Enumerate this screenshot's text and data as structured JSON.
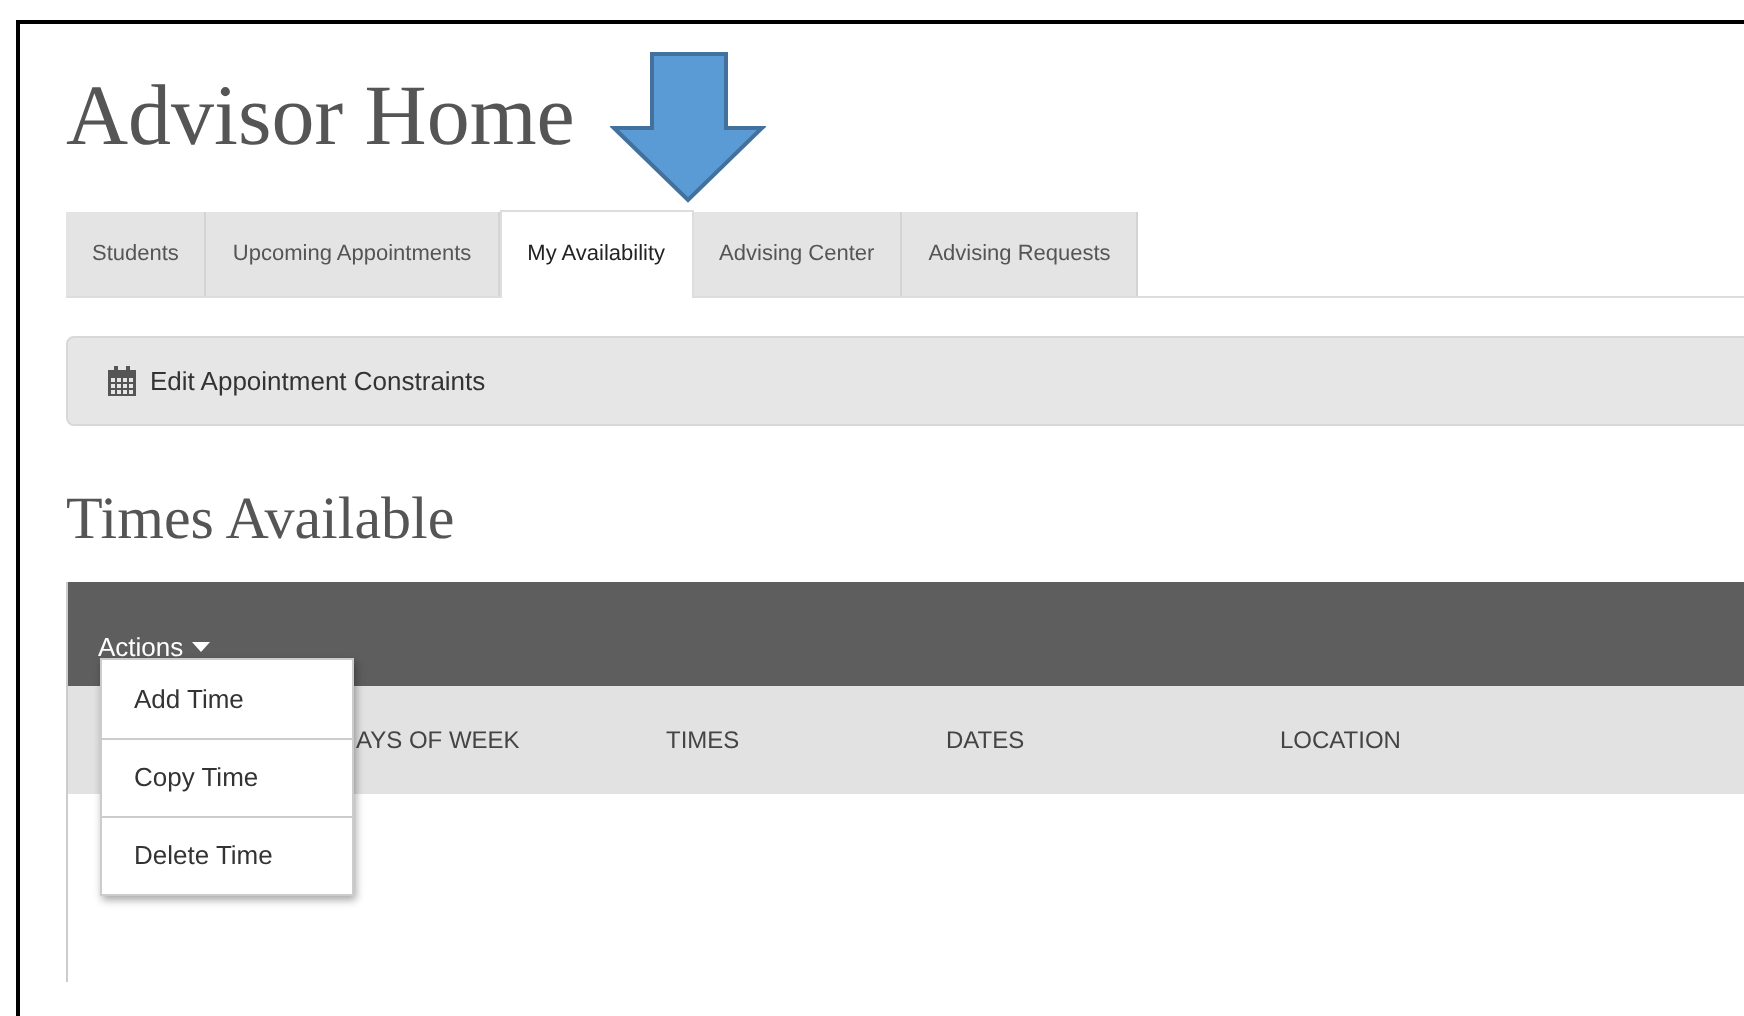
{
  "page": {
    "title": "Advisor Home"
  },
  "tabs": [
    {
      "label": "Students",
      "selected": false
    },
    {
      "label": "Upcoming Appointments",
      "selected": false
    },
    {
      "label": "My Availability",
      "selected": true
    },
    {
      "label": "Advising Center",
      "selected": false
    },
    {
      "label": "Advising Requests",
      "selected": false
    }
  ],
  "toolbar": {
    "button": "Edit Appointment Constraints"
  },
  "section": {
    "title": "Times Available"
  },
  "table": {
    "actions": "Actions",
    "columns": [
      "AYS OF WEEK",
      "TIMES",
      "DATES",
      "LOCATION"
    ]
  },
  "actions_menu": {
    "items": [
      "Add Time",
      "Copy Time",
      "Delete Time"
    ]
  }
}
